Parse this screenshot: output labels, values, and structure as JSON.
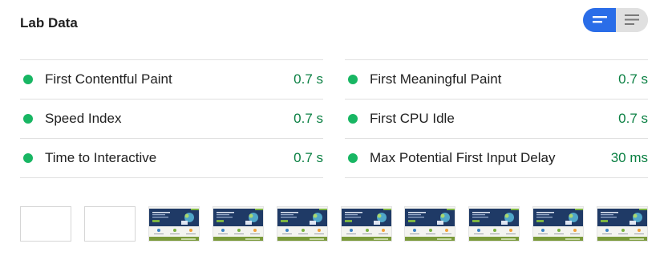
{
  "header": {
    "title": "Lab Data"
  },
  "view_toggle": {
    "active": "metric-view-icon",
    "inactive": "list-view-icon",
    "active_color": "#2a6de8"
  },
  "metrics": {
    "left": [
      {
        "label": "First Contentful Paint",
        "value": "0.7 s",
        "status": "pass"
      },
      {
        "label": "Speed Index",
        "value": "0.7 s",
        "status": "pass"
      },
      {
        "label": "Time to Interactive",
        "value": "0.7 s",
        "status": "pass"
      }
    ],
    "right": [
      {
        "label": "First Meaningful Paint",
        "value": "0.7 s",
        "status": "pass"
      },
      {
        "label": "First CPU Idle",
        "value": "0.7 s",
        "status": "pass"
      },
      {
        "label": "Max Potential First Input Delay",
        "value": "30 ms",
        "status": "pass"
      }
    ],
    "pass_color": "#18b663",
    "value_color": "#0b8043"
  },
  "filmstrip": {
    "frames": [
      "blank",
      "blank",
      "page",
      "page",
      "page",
      "page",
      "page",
      "page",
      "page",
      "page"
    ]
  }
}
